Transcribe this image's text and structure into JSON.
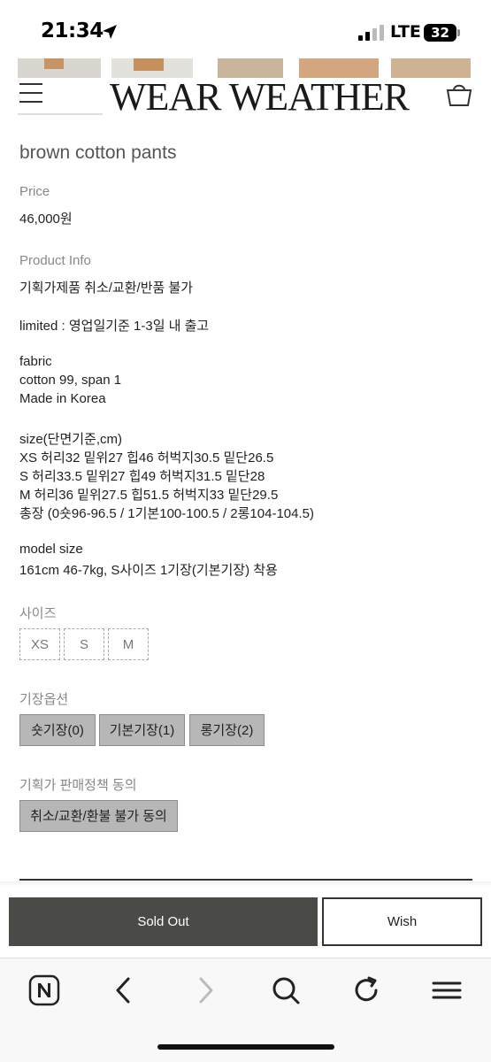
{
  "status_bar": {
    "time": "21:34",
    "network": "LTE",
    "battery": "32"
  },
  "header": {
    "brand": "WEAR WEATHER",
    "icons": [
      "menu-icon",
      "cart-icon"
    ]
  },
  "product": {
    "name": "brown cotton pants",
    "price_label": "Price",
    "price": "46,000원",
    "info_label": "Product Info",
    "info_lines": [
      "기획가제품 취소/교환/반품 불가",
      "limited : 영업일기준 1-3일 내 출고",
      "fabric",
      "cotton 99, span 1",
      "Made in Korea",
      "size(단면기준,cm)",
      "XS 허리32 밑위27 힙46 허벅지30.5 밑단26.5",
      "S 허리33.5 밑위27 힙49 허벅지31.5 밑단28",
      "M 허리36 밑위27.5 힙51.5 허벅지33 밑단29.5",
      "총장 (0숏96-96.5 / 1기본100-100.5 / 2롱104-104.5)",
      "model size",
      "161cm 46-7kg, S사이즈 1기장(기본기장) 착용"
    ]
  },
  "options": {
    "size_label": "사이즈",
    "sizes": [
      "XS",
      "S",
      "M"
    ],
    "length_label": "기장옵션",
    "lengths": [
      "숏기장(0)",
      "기본기장(1)",
      "롱기장(2)"
    ],
    "policy_label": "기획가 판매정책 동의",
    "policy_option": "취소/교환/환불 불가 동의"
  },
  "actions": {
    "sold_out": "Sold Out",
    "wish": "Wish"
  },
  "browser_toolbar": {
    "icons": [
      "naver-icon",
      "back-icon",
      "forward-icon",
      "search-icon",
      "refresh-icon",
      "menu-icon"
    ]
  }
}
